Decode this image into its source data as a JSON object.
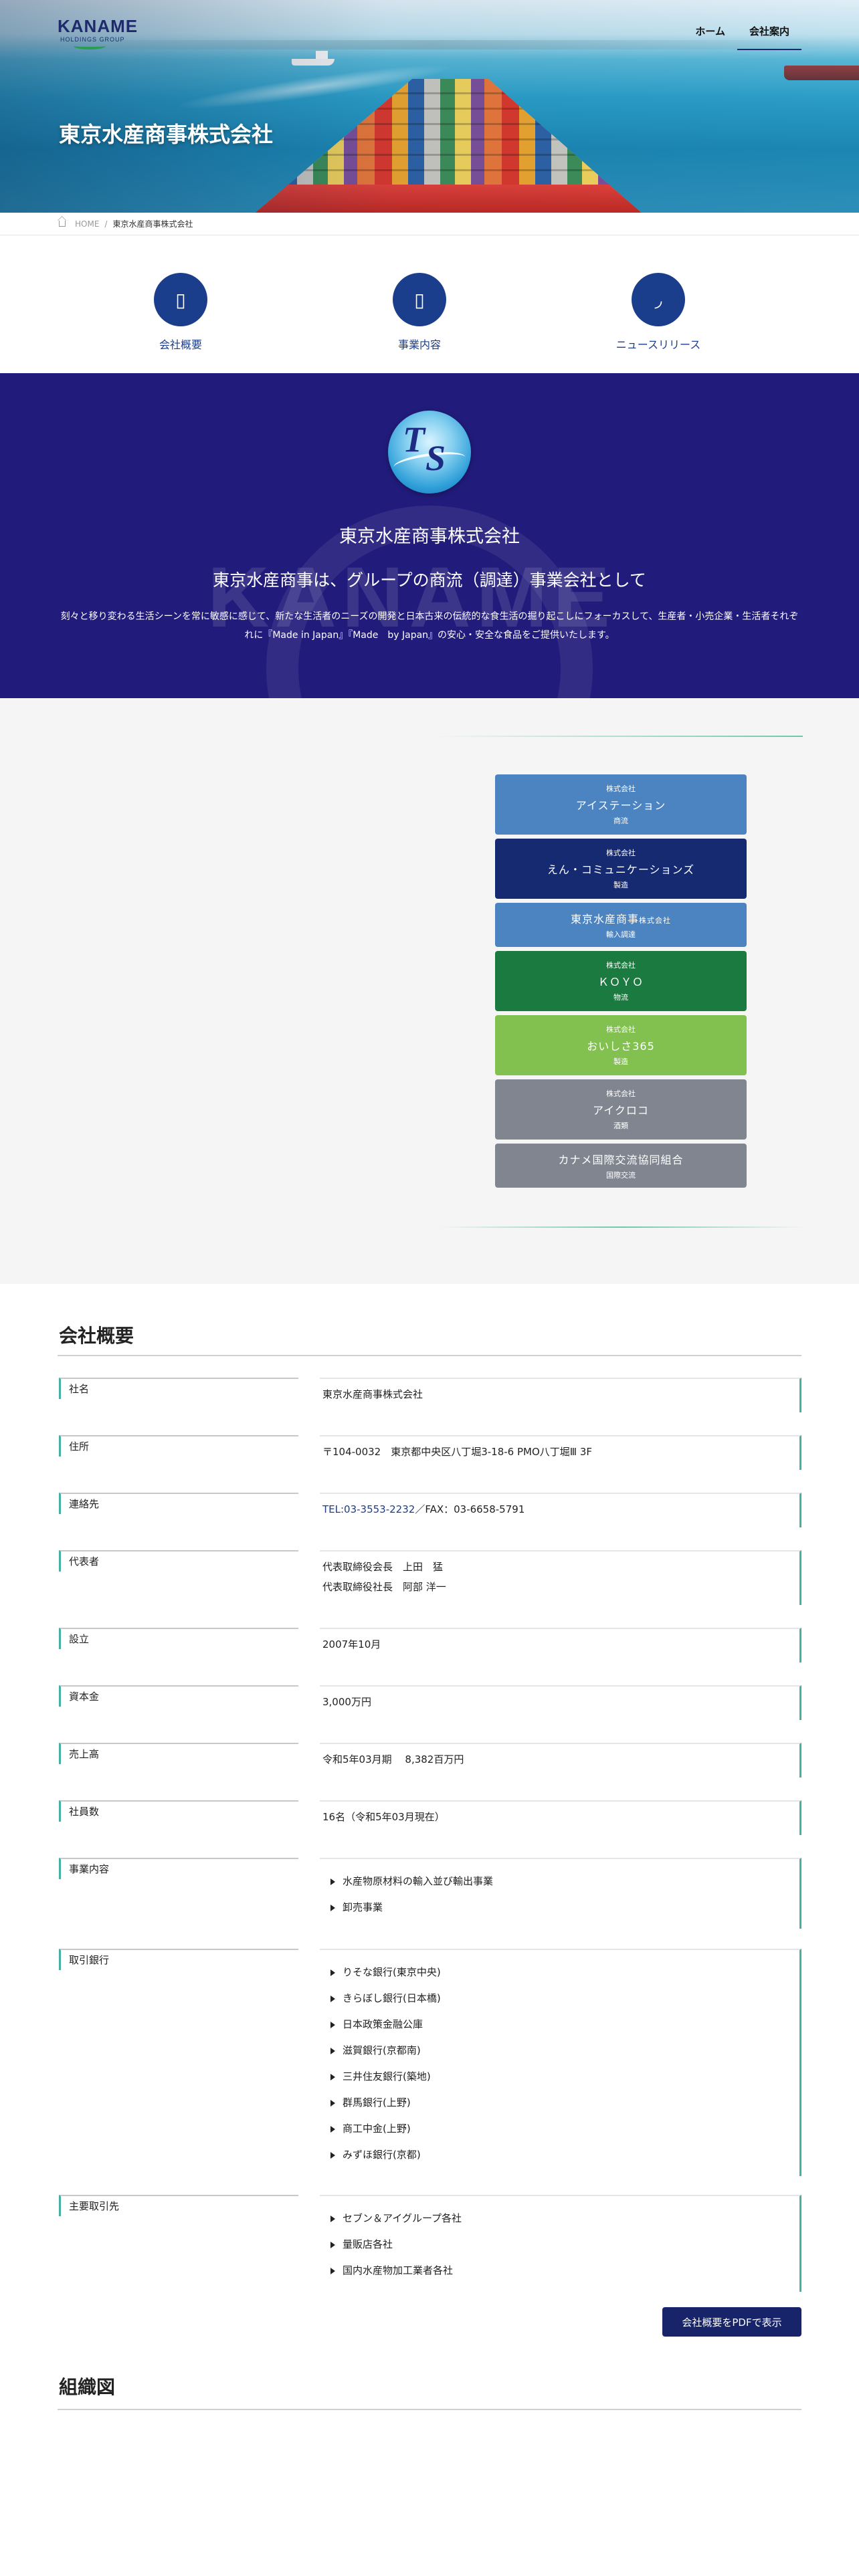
{
  "header": {
    "logo_text": "KANAME",
    "logo_subtext": "HOLDINGS GROUP",
    "nav": [
      {
        "label": "ホーム",
        "active": false
      },
      {
        "label": "会社案内",
        "active": true
      }
    ],
    "hero_title": "東京水産商事株式会社"
  },
  "breadcrumb": {
    "home": "HOME",
    "separator": "/",
    "current": "東京水産商事株式会社"
  },
  "icon_nav": [
    {
      "label": "会社概要",
      "icon": "building-icon",
      "glyph": "▯"
    },
    {
      "label": "事業内容",
      "icon": "document-icon",
      "glyph": "▯"
    },
    {
      "label": "ニュースリリース",
      "icon": "megaphone-icon",
      "glyph": "◞"
    }
  ],
  "intro": {
    "logo_letters": [
      "T",
      "S"
    ],
    "watermark": "KANAME",
    "company_name": "東京水産商事株式会社",
    "tagline": "東京水産商事は、グループの商流（調達）事業会社として",
    "description": "刻々と移り変わる生活シーンを常に敏感に感じて、新たな生活者のニーズの開発と日本古来の伝統的な食生活の掘り起こしにフォーカスして、生産者・小売企業・生活者それぞれに『Made in Japan』『Made　by Japan』の安心・安全な食品をご提供いたします。"
  },
  "group_companies": [
    {
      "prefix": "株式会社",
      "name": "アイステーション",
      "category": "商流",
      "color": "#4c84c2"
    },
    {
      "prefix": "株式会社",
      "name": "えん・コミュニケーションズ",
      "category": "製造",
      "color": "#162a72"
    },
    {
      "prefix": "",
      "name": "東京水産商事",
      "name_suffix": "株式会社",
      "category": "輸入調達",
      "color": "#4c84c2"
    },
    {
      "prefix": "株式会社",
      "name": "ＫＯＹＯ",
      "category": "物流",
      "color": "#1b7a3f"
    },
    {
      "prefix": "株式会社",
      "name": "おいしさ365",
      "category": "製造",
      "color": "#82c04f"
    },
    {
      "prefix": "株式会社",
      "name": "アイクロコ",
      "category": "酒類",
      "color": "#808590"
    },
    {
      "prefix": "",
      "name": "カナメ国際交流協同組合",
      "category": "国際交流",
      "color": "#808590"
    }
  ],
  "overview": {
    "title": "会社概要",
    "rows": [
      {
        "label": "社名",
        "value": "東京水産商事株式会社"
      },
      {
        "label": "住所",
        "value": "〒104-0032　東京都中央区八丁堀3-18-6 PMO八丁堀Ⅲ 3F"
      },
      {
        "label": "連絡先",
        "tel": "TEL:03-3553-2232",
        "fax": "／FAX：03-6658-5791"
      },
      {
        "label": "代表者",
        "lines": [
          "代表取締役会長　上田　猛",
          "代表取締役社長　阿部 洋一"
        ]
      },
      {
        "label": "設立",
        "value": "2007年10月"
      },
      {
        "label": "資本金",
        "value": "3,000万円"
      },
      {
        "label": "売上高",
        "value": "令和5年03月期　 8,382百万円"
      },
      {
        "label": "社員数",
        "value": "16名（令和5年03月現在）"
      },
      {
        "label": "事業内容",
        "items": [
          "水産物原材料の輸入並び輸出事業",
          "卸売事業"
        ]
      },
      {
        "label": "取引銀行",
        "items": [
          "りそな銀行(東京中央)",
          "きらぼし銀行(日本橋)",
          "日本政策金融公庫",
          "滋賀銀行(京都南)",
          "三井住友銀行(築地)",
          "群馬銀行(上野)",
          "商工中金(上野)",
          "みずほ銀行(京都)"
        ]
      },
      {
        "label": "主要取引先",
        "items": [
          "セブン＆アイグループ各社",
          "量販店各社",
          "国内水産物加工業者各社"
        ]
      }
    ],
    "pdf_button": "会社概要をPDFで表示"
  },
  "org_chart": {
    "title": "組織図"
  },
  "colors": {
    "brand_navy": "#211b7b",
    "icon_blue": "#1a3d8c",
    "accent_teal": "#44b0a6",
    "button_navy": "#17246a"
  }
}
